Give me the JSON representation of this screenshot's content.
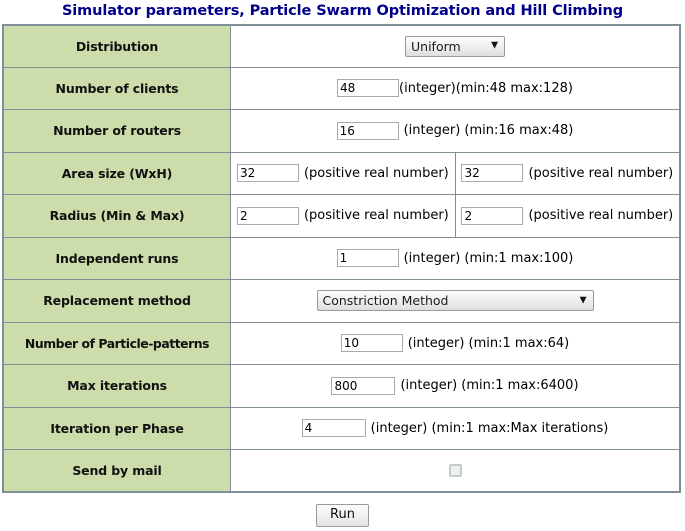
{
  "page": {
    "title": "Simulator parameters, Particle Swarm Optimization and Hill Climbing",
    "title_color": "#00008b",
    "label_bg_color": "#cddcab",
    "border_color": "#7e8f98"
  },
  "rows": [
    {
      "label": "Distribution",
      "type": "select",
      "value": "Uniform",
      "options": [
        "Uniform"
      ],
      "arrow": "▼"
    },
    {
      "label": "Number of clients",
      "type": "text",
      "value": "48",
      "hint": "(integer)(min:48 max:128)",
      "hint_gap": false
    },
    {
      "label": "Number of routers",
      "type": "text",
      "value": "16",
      "hint": "(integer) (min:16 max:48)",
      "hint_gap": true
    },
    {
      "label": "Area size (WxH)",
      "type": "text-pair",
      "value1": "32",
      "hint1": "(positive real number)",
      "value2": "32",
      "hint2": "(positive real number)"
    },
    {
      "label": "Radius (Min & Max)",
      "type": "text-pair",
      "value1": "2",
      "hint1": "(positive real number)",
      "value2": "2",
      "hint2": "(positive real number)"
    },
    {
      "label": "Independent runs",
      "type": "text",
      "value": "1",
      "hint": "(integer) (min:1 max:100)",
      "hint_gap": true
    },
    {
      "label": "Replacement method",
      "type": "select",
      "value": "Constriction Method",
      "options": [
        "Constriction Method"
      ],
      "arrow": "▼"
    },
    {
      "label": "Number of Particle-patterns",
      "type": "text",
      "value": "10",
      "hint": "(integer) (min:1 max:64)",
      "hint_gap": true
    },
    {
      "label": "Max iterations",
      "type": "text",
      "value": "800",
      "hint": "(integer) (min:1 max:6400)",
      "hint_gap": true
    },
    {
      "label": "Iteration per Phase",
      "type": "text",
      "value": "4",
      "hint": "(integer) (min:1 max:Max iterations)",
      "hint_gap": true
    },
    {
      "label": "Send by mail",
      "type": "checkbox",
      "checked": false
    }
  ],
  "run_button": {
    "label": "Run"
  }
}
